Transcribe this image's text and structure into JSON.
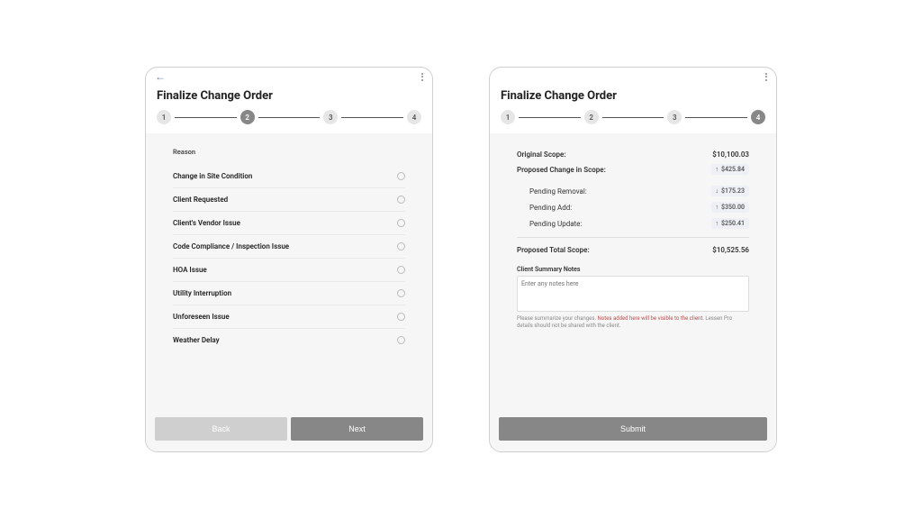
{
  "left": {
    "title": "Finalize Change Order",
    "steps": [
      "1",
      "2",
      "3",
      "4"
    ],
    "active_step_index": 1,
    "reason_label": "Reason",
    "reasons": [
      "Change in Site Condition",
      "Client Requested",
      "Client's Vendor Issue",
      "Code Compliance / Inspection Issue",
      "HOA Issue",
      "Utility Interruption",
      "Unforeseen Issue",
      "Weather Delay"
    ],
    "back_label": "Back",
    "next_label": "Next"
  },
  "right": {
    "title": "Finalize Change Order",
    "steps": [
      "1",
      "2",
      "3",
      "4"
    ],
    "active_step_index": 3,
    "rows": {
      "original_scope_label": "Original Scope:",
      "original_scope_value": "$10,100.03",
      "proposed_change_label": "Proposed Change in Scope:",
      "proposed_change_value": "$425.84",
      "proposed_change_dir": "up",
      "pending_removal_label": "Pending Removal:",
      "pending_removal_value": "$175.23",
      "pending_removal_dir": "down",
      "pending_add_label": "Pending Add:",
      "pending_add_value": "$350.00",
      "pending_add_dir": "up",
      "pending_update_label": "Pending Update:",
      "pending_update_value": "$250.41",
      "pending_update_dir": "up",
      "proposed_total_label": "Proposed Total Scope:",
      "proposed_total_value": "$10,525.56"
    },
    "notes_label": "Client Summary Notes",
    "notes_placeholder": "Enter any notes here",
    "notes_help_1": "Please summarize your changes. ",
    "notes_help_2": "Notes added here will be visible to the client.",
    "notes_help_3": " Lessen Pro details should not be shared with the client.",
    "submit_label": "Submit"
  }
}
